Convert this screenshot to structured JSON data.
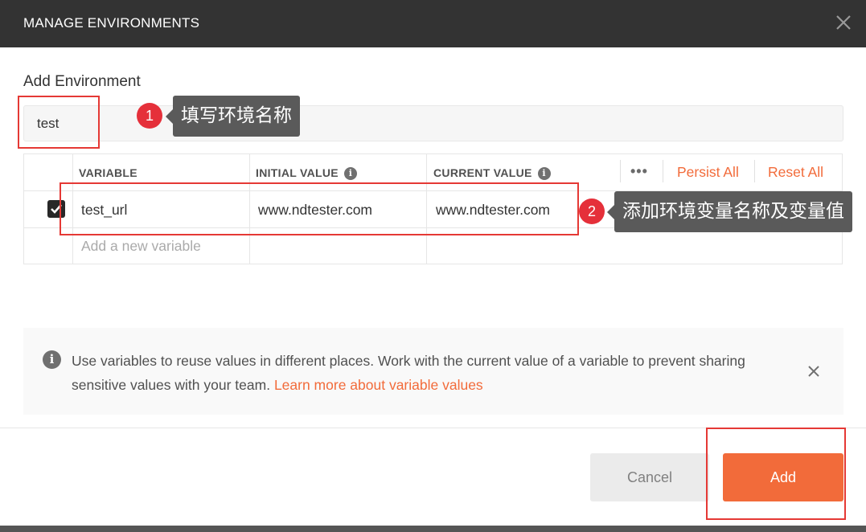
{
  "header": {
    "title": "MANAGE ENVIRONMENTS",
    "close_icon": "close-icon"
  },
  "environment": {
    "section_label": "Add Environment",
    "name_value": "test"
  },
  "annotations": {
    "step1_number": "1",
    "step1_text": "填写环境名称",
    "step2_number": "2",
    "step2_text": "添加环境变量名称及变量值",
    "highlight_color": "#e53935"
  },
  "table": {
    "columns": [
      "VARIABLE",
      "INITIAL VALUE",
      "CURRENT VALUE"
    ],
    "more_icon": "•••",
    "persist_all": "Persist All",
    "reset_all": "Reset All",
    "rows": [
      {
        "enabled": true,
        "variable": "test_url",
        "initial_value": "www.ndtester.com",
        "current_value": "www.ndtester.com"
      }
    ],
    "new_variable_placeholder": "Add a new variable"
  },
  "info": {
    "icon": "info-icon",
    "text": "Use variables to reuse values in different places. Work with the current value of a variable to prevent sharing sensitive values with your team.",
    "link_text": "Learn more about variable values"
  },
  "footer": {
    "cancel_label": "Cancel",
    "add_label": "Add"
  },
  "colors": {
    "accent": "#f26b3a",
    "header_bg": "#333333",
    "badge": "#e5303a",
    "tooltip_bg": "#5a5a5a"
  }
}
